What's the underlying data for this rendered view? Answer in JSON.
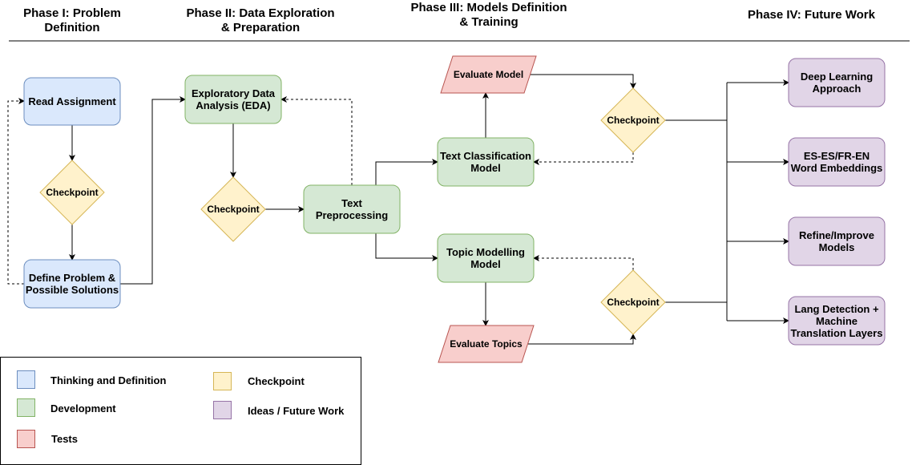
{
  "colors": {
    "thinking_fill": "#dae8fc",
    "thinking_stroke": "#6c8ebf",
    "dev_fill": "#d5e8d4",
    "dev_stroke": "#82b366",
    "test_fill": "#f8cecc",
    "test_stroke": "#b85450",
    "checkpoint_fill": "#fff2cc",
    "checkpoint_stroke": "#d6b656",
    "future_fill": "#e1d5e7",
    "future_stroke": "#9673a6"
  },
  "headers": [
    "Phase I: Problem\nDefinition",
    "Phase II: Data Exploration\n& Preparation",
    "Phase III: Models Definition\n& Training",
    "Phase IV: Future Work"
  ],
  "nodes": {
    "read_assignment": "Read Assignment",
    "define_problem": "Define Problem &\nPossible Solutions",
    "eda": "Exploratory Data\nAnalysis (EDA)",
    "text_preprocessing": "Text\nPreprocessing",
    "text_classification": "Text Classification\nModel",
    "topic_modelling": "Topic Modelling\nModel",
    "evaluate_model": "Evaluate Model",
    "evaluate_topics": "Evaluate Topics",
    "checkpoint": "Checkpoint",
    "deep_learning": "Deep Learning\nApproach",
    "word_embeddings": "ES-ES/FR-EN\nWord Embeddings",
    "refine": "Refine/Improve\nModels",
    "lang_detection": "Lang Detection +\nMachine\nTranslation Layers"
  },
  "legend": {
    "thinking": "Thinking and Definition",
    "development": "Development",
    "tests": "Tests",
    "checkpoint": "Checkpoint",
    "future": "Ideas / Future Work"
  }
}
